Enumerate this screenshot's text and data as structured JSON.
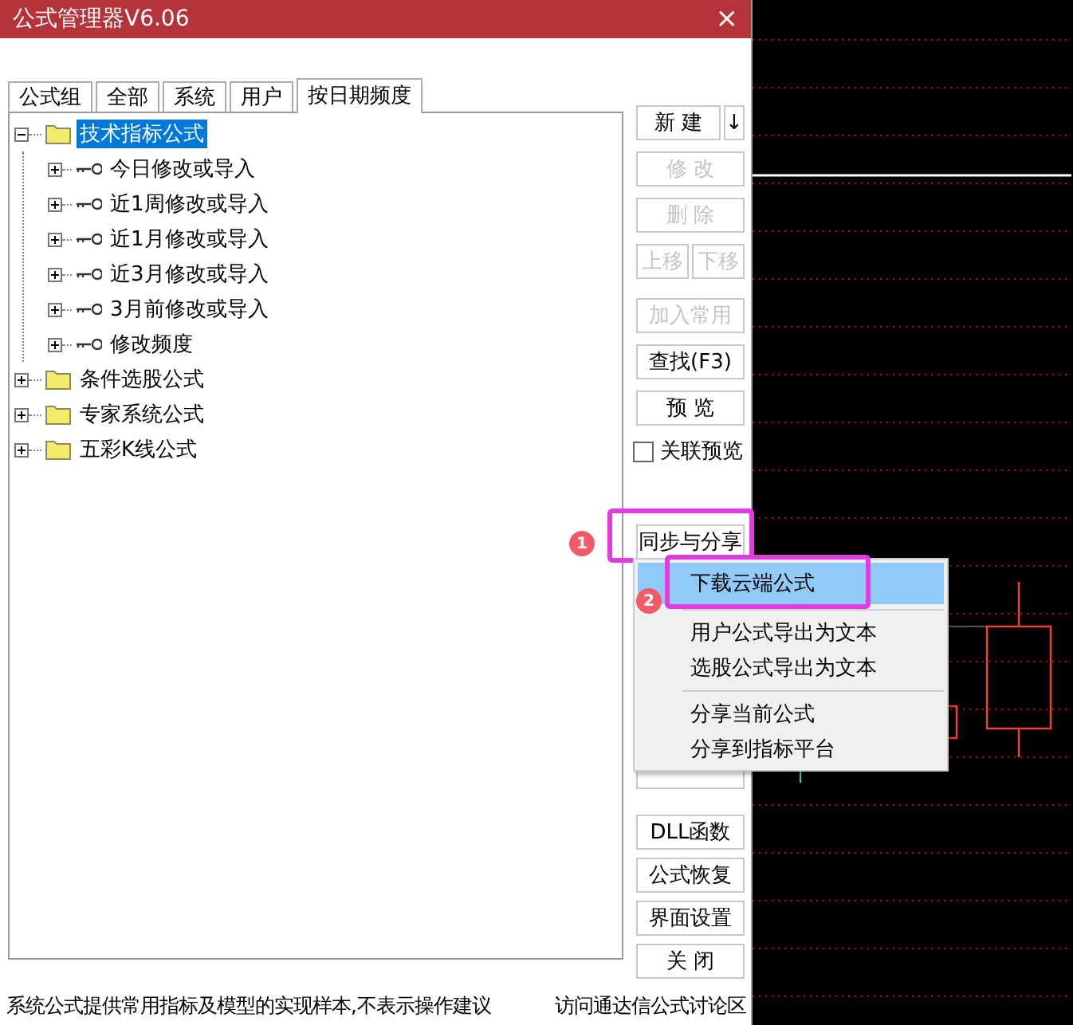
{
  "window": {
    "title": "公式管理器V6.06",
    "close": "×"
  },
  "tabs": [
    {
      "label": "公式组",
      "selected": false
    },
    {
      "label": "全部",
      "selected": false
    },
    {
      "label": "系统",
      "selected": false
    },
    {
      "label": "用户",
      "selected": false
    },
    {
      "label": "按日期频度",
      "selected": true
    }
  ],
  "tree": [
    {
      "label": "技术指标公式",
      "kind": "folder",
      "expanded": true,
      "selected": true,
      "children": [
        {
          "label": "今日修改或导入",
          "kind": "formula",
          "expanded": false,
          "selected": false
        },
        {
          "label": "近1周修改或导入",
          "kind": "formula",
          "expanded": false,
          "selected": false
        },
        {
          "label": "近1月修改或导入",
          "kind": "formula",
          "expanded": false,
          "selected": false
        },
        {
          "label": "近3月修改或导入",
          "kind": "formula",
          "expanded": false,
          "selected": false
        },
        {
          "label": "3月前修改或导入",
          "kind": "formula",
          "expanded": false,
          "selected": false
        },
        {
          "label": "修改频度",
          "kind": "formula",
          "expanded": false,
          "selected": false
        }
      ]
    },
    {
      "label": "条件选股公式",
      "kind": "folder",
      "expanded": false,
      "selected": false
    },
    {
      "label": "专家系统公式",
      "kind": "folder",
      "expanded": false,
      "selected": false
    },
    {
      "label": "五彩K线公式",
      "kind": "folder",
      "expanded": false,
      "selected": false
    }
  ],
  "buttons_top": [
    [
      {
        "label": "新 建",
        "disabled": false
      },
      {
        "label": "↓",
        "disabled": false
      }
    ],
    [
      {
        "label": "修 改",
        "disabled": true
      }
    ],
    [
      {
        "label": "删 除",
        "disabled": true
      }
    ],
    [
      {
        "label": "上移",
        "disabled": true
      },
      {
        "label": "下移",
        "disabled": true
      }
    ],
    [
      {
        "label": "加入常用",
        "disabled": true
      }
    ],
    [
      {
        "label": "查找(F3)",
        "disabled": false
      }
    ],
    [
      {
        "label": "预 览",
        "disabled": false
      }
    ]
  ],
  "linked_preview": {
    "label": "关联预览",
    "checked": false
  },
  "sync_button": {
    "label": "同步与分享",
    "badge": "1"
  },
  "buttons_bottom": [
    {
      "label": "DLL函数",
      "disabled": false
    },
    {
      "label": "公式恢复",
      "disabled": false
    },
    {
      "label": "界面设置",
      "disabled": false
    },
    {
      "label": "关 闭",
      "disabled": false
    }
  ],
  "menu": {
    "badge": "2",
    "groups": [
      [
        {
          "label": "下载云端公式",
          "selected": true
        }
      ],
      [
        {
          "label": "用户公式导出为文本",
          "selected": false
        },
        {
          "label": "选股公式导出为文本",
          "selected": false
        }
      ],
      [
        {
          "label": "分享当前公式",
          "selected": false
        },
        {
          "label": "分享到指标平台",
          "selected": false
        }
      ]
    ]
  },
  "status_bar": {
    "text": "系统公式提供常用指标及模型的实现样本,不表示操作建议",
    "link": "访问通达信公式讨论区"
  }
}
